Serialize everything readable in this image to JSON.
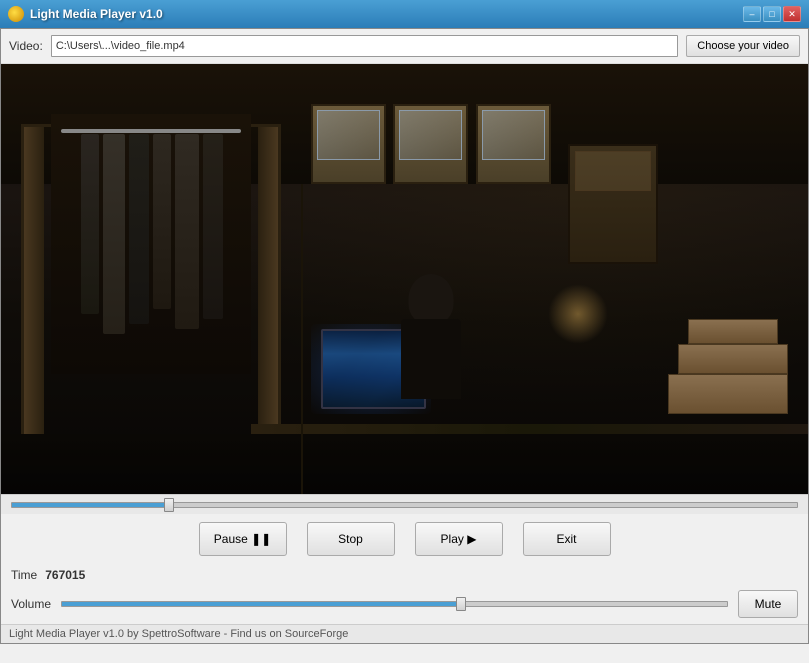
{
  "titleBar": {
    "title": "Light Media Player v1.0"
  },
  "fileBar": {
    "label": "Video:",
    "filePath": "C:\\Users\\...\\video_file.mp4",
    "chooseButton": "Choose your video"
  },
  "controls": {
    "pauseButton": "Pause ❚❚",
    "stopButton": "Stop",
    "playButton": "Play ▶",
    "exitButton": "Exit",
    "muteButton": "Mute"
  },
  "status": {
    "timeLabel": "Time",
    "timeValue": "767015",
    "volumeLabel": "Volume"
  },
  "titleBtns": {
    "minimize": "–",
    "maximize": "□",
    "close": "✕"
  },
  "footer": {
    "text": "Light Media Player v1.0 by SpettroSoftware - Find us on SourceForge"
  }
}
